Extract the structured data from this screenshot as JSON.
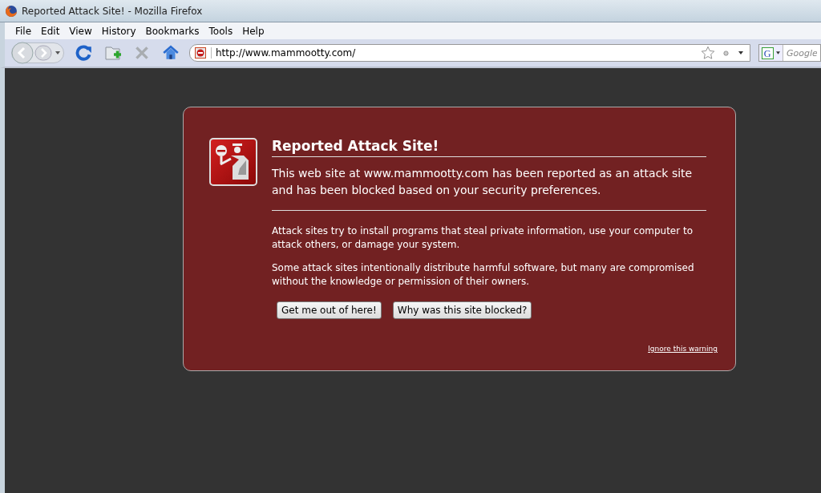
{
  "window": {
    "title": "Reported Attack Site! - Mozilla Firefox"
  },
  "menu": [
    "File",
    "Edit",
    "View",
    "History",
    "Bookmarks",
    "Tools",
    "Help"
  ],
  "toolbar": {
    "url": "http://www.mammootty.com/",
    "search_engine_letter": "G",
    "search_placeholder": "Google"
  },
  "warning": {
    "title": "Reported Attack Site!",
    "lead": "This web site at www.mammootty.com has been reported as an attack site and has been blocked based on your security preferences.",
    "paragraphs": [
      "Attack sites try to install programs that steal private information, use your computer to attack others, or damage your system.",
      "Some attack sites intentionally distribute harmful software, but many are compromised without the knowledge or permission of their owners."
    ],
    "buttons": [
      "Get me out of here!",
      "Why was this site blocked?"
    ],
    "ignore_link": "Ignore this warning"
  }
}
